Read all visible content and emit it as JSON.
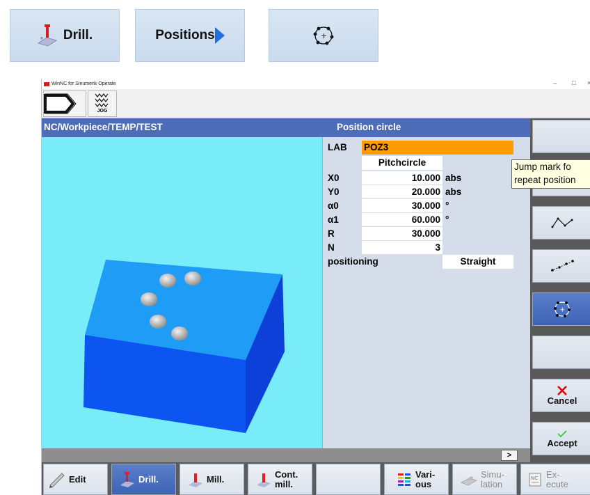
{
  "top_keys": {
    "drill_label": "Drill.",
    "positions_label": "Positions"
  },
  "window": {
    "title": "WinNC for Sinumerik Operate",
    "controls": [
      "–",
      "□",
      "×"
    ],
    "jog_label": "JOG"
  },
  "header": {
    "path": "NC/Workpiece/TEMP/TEST",
    "dialog_title": "Position circle"
  },
  "params": {
    "lab": {
      "name": "LAB",
      "value": "POZ3"
    },
    "mode": "Pitchcircle",
    "x0": {
      "name": "X0",
      "value": "10.000",
      "unit": "abs"
    },
    "y0": {
      "name": "Y0",
      "value": "20.000",
      "unit": "abs"
    },
    "a0": {
      "name": "α0",
      "value": "30.000",
      "unit": "°"
    },
    "a1": {
      "name": "α1",
      "value": "60.000",
      "unit": "°"
    },
    "r": {
      "name": "R",
      "value": "30.000"
    },
    "n": {
      "name": "N",
      "value": "3"
    },
    "positioning": {
      "name": "positioning",
      "value": "Straight"
    }
  },
  "tooltip": {
    "line1": "Jump mark fo",
    "line2": "repeat position"
  },
  "status": {
    "more": ">"
  },
  "vertical_keys": {
    "cancel": "Cancel",
    "accept": "Accept"
  },
  "bottom_keys": {
    "edit": "Edit",
    "drill": "Drill.",
    "mill": "Mill.",
    "cont_mill_1": "Cont.",
    "cont_mill_2": "mill.",
    "various_1": "Vari-",
    "various_2": "ous",
    "simulation_1": "Simu-",
    "simulation_2": "lation",
    "execute_1": "Ex-",
    "execute_2": "ecute"
  },
  "colors": {
    "header_blue": "#4d6db8",
    "lab_orange": "#ff9c00",
    "viewport_cyan": "#78ecf8",
    "active_key_blue": "#3d63b5"
  }
}
